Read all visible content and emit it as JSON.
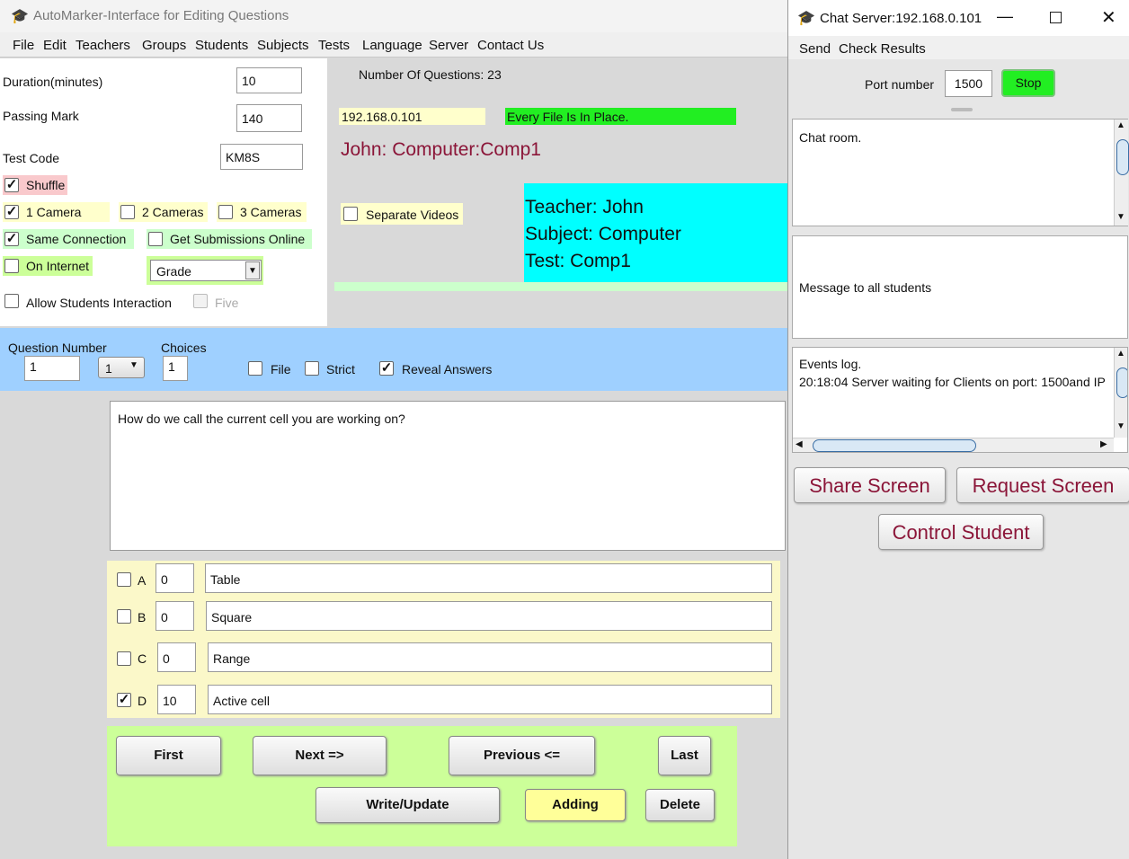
{
  "main_window": {
    "title": "AutoMarker-Interface for Editing Questions",
    "menu": [
      "File",
      "Edit",
      "Teachers",
      "Groups",
      "Students",
      "Subjects",
      "Tests",
      "Language",
      "Server",
      "Contact Us"
    ],
    "settings": {
      "duration_label": "Duration(minutes)",
      "duration_value": "10",
      "passing_label": "Passing Mark",
      "passing_value": "140",
      "testcode_label": "Test Code",
      "testcode_value": "KM8S",
      "shuffle": {
        "label": "Shuffle",
        "checked": true
      },
      "camera1": {
        "label": "1 Camera",
        "checked": true
      },
      "camera2": {
        "label": "2 Cameras",
        "checked": false
      },
      "camera3": {
        "label": "3 Cameras",
        "checked": false
      },
      "same_connection": {
        "label": "Same Connection",
        "checked": true
      },
      "get_submissions": {
        "label": "Get Submissions Online",
        "checked": false
      },
      "on_internet": {
        "label": "On Internet",
        "checked": false
      },
      "grade_select": "Grade",
      "allow_interaction": {
        "label": "Allow Students Interaction",
        "checked": false
      },
      "five": {
        "label": "Five",
        "checked": false
      }
    },
    "info": {
      "num_questions": "Number Of Questions: 23",
      "ip": "192.168.0.101",
      "file_status": "Every File Is In Place.",
      "session": "John: Computer:Comp1",
      "separate_videos": {
        "label": "Separate Videos",
        "checked": false
      },
      "teacher": "Teacher: John",
      "subject": "Subject: Computer",
      "test": "Test: Comp1"
    },
    "question_bar": {
      "qnum_label": "Question Number",
      "qnum_value": "1",
      "qnum_select": "1",
      "choices_label": "Choices",
      "choices_value": "1",
      "file": {
        "label": "File",
        "checked": false
      },
      "strict": {
        "label": "Strict",
        "checked": false
      },
      "reveal": {
        "label": "Reveal Answers",
        "checked": true
      }
    },
    "question_text": "How do we call the current cell you are working on?",
    "answers": [
      {
        "letter": "A",
        "checked": false,
        "mark": "0",
        "text": "Table"
      },
      {
        "letter": "B",
        "checked": false,
        "mark": "0",
        "text": "Square"
      },
      {
        "letter": "C",
        "checked": false,
        "mark": "0",
        "text": "Range"
      },
      {
        "letter": "D",
        "checked": true,
        "mark": "10",
        "text": "Active cell"
      }
    ],
    "buttons": {
      "first": "First",
      "next": "Next =>",
      "previous": "Previous <=",
      "last": "Last",
      "write": "Write/Update",
      "adding": "Adding",
      "delete": "Delete"
    }
  },
  "chat_window": {
    "title": "Chat Server:192.168.0.101",
    "menu": [
      "Send",
      "Check Results"
    ],
    "port_label": "Port number",
    "port_value": "1500",
    "stop_label": "Stop",
    "chat_room": "Chat room.",
    "message": "Message to all students",
    "events_title": "Events log.",
    "events_line": "20:18:04 Server waiting for Clients on port: 1500and IP",
    "share": "Share Screen",
    "request": "Request Screen",
    "control": "Control Student"
  },
  "colors": {
    "accent_maroon": "#8b1538",
    "status_green": "#22ee22",
    "info_cyan": "#00ffff",
    "question_bar_blue": "#9fd0ff",
    "answers_bg": "#fbf8c9",
    "nav_bg": "#ccff99"
  }
}
